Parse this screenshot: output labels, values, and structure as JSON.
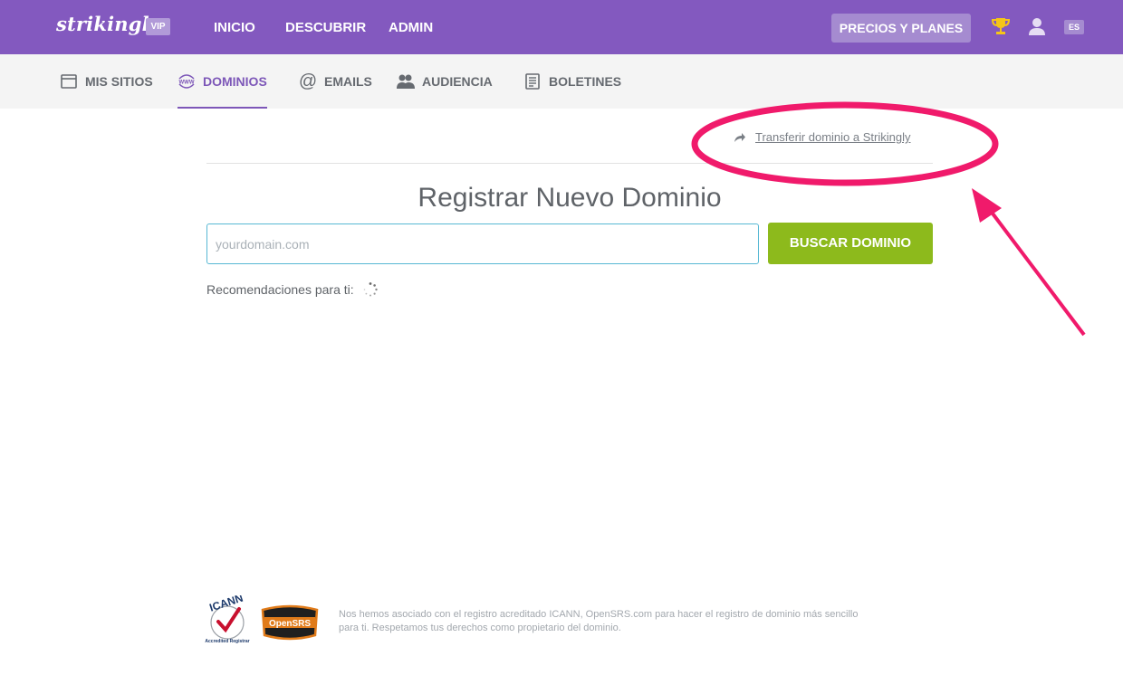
{
  "topbar": {
    "logo": "strikingly",
    "badge": "VIP",
    "nav": [
      "INICIO",
      "DESCUBRIR",
      "ADMIN"
    ],
    "pricing_label": "PRECIOS Y PLANES",
    "lang": "ES",
    "icons": [
      "trophy-icon",
      "user-icon"
    ]
  },
  "subnav": {
    "items": [
      {
        "label": "MIS SITIOS",
        "icon": "browser-window-icon"
      },
      {
        "label": "DOMINIOS",
        "icon": "www-globe-icon",
        "active": true
      },
      {
        "label": "EMAILS",
        "icon": "at-icon"
      },
      {
        "label": "AUDIENCIA",
        "icon": "people-icon"
      },
      {
        "label": "BOLETINES",
        "icon": "newsletter-icon"
      }
    ]
  },
  "main": {
    "transfer_link": "Transferir dominio a Strikingly",
    "title": "Registrar Nuevo Dominio",
    "input_placeholder": "yourdomain.com",
    "search_button": "BUSCAR DOMINIO",
    "recommendations_label": "Recomendaciones para ti:"
  },
  "footer": {
    "text_line1": "Nos hemos asociado con el registro acreditado ICANN, OpenSRS.com para hacer el registro de dominio más sencillo",
    "text_line2": "para ti. Respetamos tus derechos como propietario del dominio.",
    "icann_logo_text": "ICANN",
    "icann_sub_text": "Accredited Registrar",
    "opensrs_logo_text": "OpenSRS"
  },
  "colors": {
    "topbar": "#8359bf",
    "active": "#7d57b8",
    "search_button": "#8dba1c",
    "annotation": "#f01a6b"
  }
}
